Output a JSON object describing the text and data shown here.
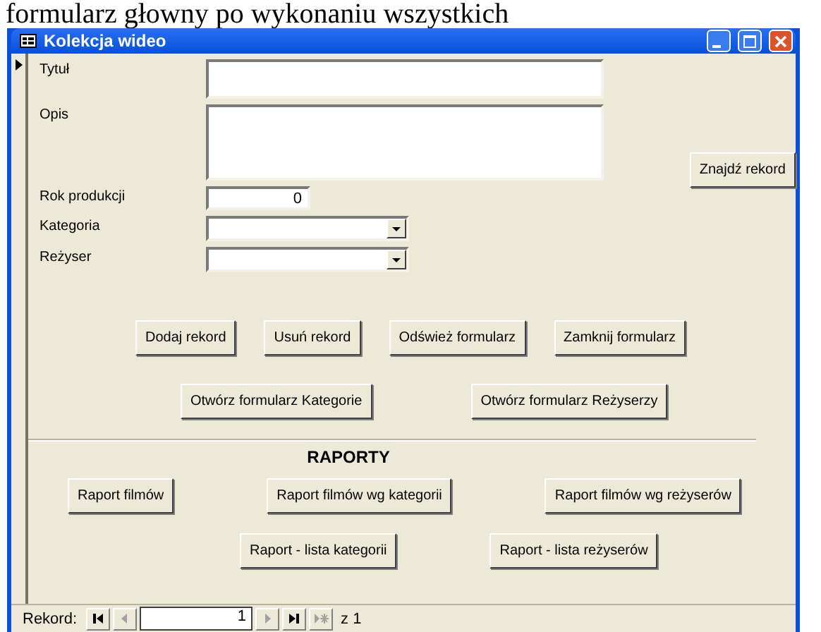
{
  "document_text": "formularz głowny po wykonaniu wszystkich",
  "window": {
    "title": "Kolekcja wideo"
  },
  "fields": [
    {
      "label": "Tytuł",
      "kind": "text"
    },
    {
      "label": "Opis",
      "kind": "memo"
    },
    {
      "label": "Rok produkcji",
      "kind": "number",
      "value": "0"
    },
    {
      "label": "Kategoria",
      "kind": "combo"
    },
    {
      "label": "Reżyser",
      "kind": "combo"
    }
  ],
  "find_button": "Znajdź rekord",
  "action_rows": [
    [
      "Dodaj rekord",
      "Usuń rekord",
      "Odśwież formularz",
      "Zamknij formularz"
    ],
    [
      "Otwórz formularz Kategorie",
      "Otwórz formularz Reżyserzy"
    ]
  ],
  "section_title": "RAPORTY",
  "report_rows": [
    [
      "Raport filmów",
      "Raport filmów wg kategorii",
      "Raport filmów wg reżyserów"
    ],
    [
      "Raport - lista kategorii",
      "Raport - lista reżyserów"
    ]
  ],
  "navigation": {
    "label": "Rekord:",
    "current": "1",
    "of": "z",
    "total": "1"
  }
}
